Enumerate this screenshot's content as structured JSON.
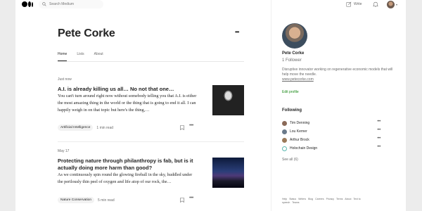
{
  "topbar": {
    "search_placeholder": "Search Medium",
    "write_label": "Write"
  },
  "profile": {
    "name": "Pete Corke",
    "tabs": [
      {
        "label": "Home",
        "active": true
      },
      {
        "label": "Lists",
        "active": false
      },
      {
        "label": "About",
        "active": false
      }
    ]
  },
  "articles": [
    {
      "date": "Just now",
      "title": "A.I. is already killing us all… No not that one…",
      "excerpt": "You can't turn around right now without somebody telling you that A.I. is either the most amazing thing in the world or the thing that is going to end it all. I can happily weigh in on that topic but here's the thing,…",
      "tag": "Artificial Intelligence",
      "read_time": "1 min read"
    },
    {
      "date": "May 17",
      "title": "Protecting nature through philanthropy is fab, but is it actually doing more harm than good?",
      "excerpt": "As we continuously spin round the glowing fireball in the sky, huddled under the perilously thin peel of oxygen and life atop of our rock, the…",
      "tag": "Nature Conservation",
      "read_time": "5 min read"
    }
  ],
  "sidebar": {
    "name": "Pete Corke",
    "followers": "1 Follower",
    "bio": "Disruptive innovator working on regenerative economic models that will help move the needle.",
    "link": "www.petecorke.com",
    "edit_profile": "Edit profile",
    "following_title": "Following",
    "following": [
      {
        "name": "Tim Denning",
        "color": "#8a6a58"
      },
      {
        "name": "Lou Kerner",
        "color": "#6a7a8a"
      },
      {
        "name": "Arthur Brock",
        "color": "#9a7a5a"
      },
      {
        "name": "Holochain Design",
        "color": "#5ab8b0"
      }
    ],
    "see_all": "See all (6)",
    "footer_links": [
      "Help",
      "Status",
      "Writers",
      "Blog",
      "Careers",
      "Privacy",
      "Terms",
      "About",
      "Text to speech",
      "Teams"
    ]
  },
  "colors": {
    "accent_green": "#1a8917",
    "text": "#242424",
    "muted": "#6b6b6b"
  }
}
